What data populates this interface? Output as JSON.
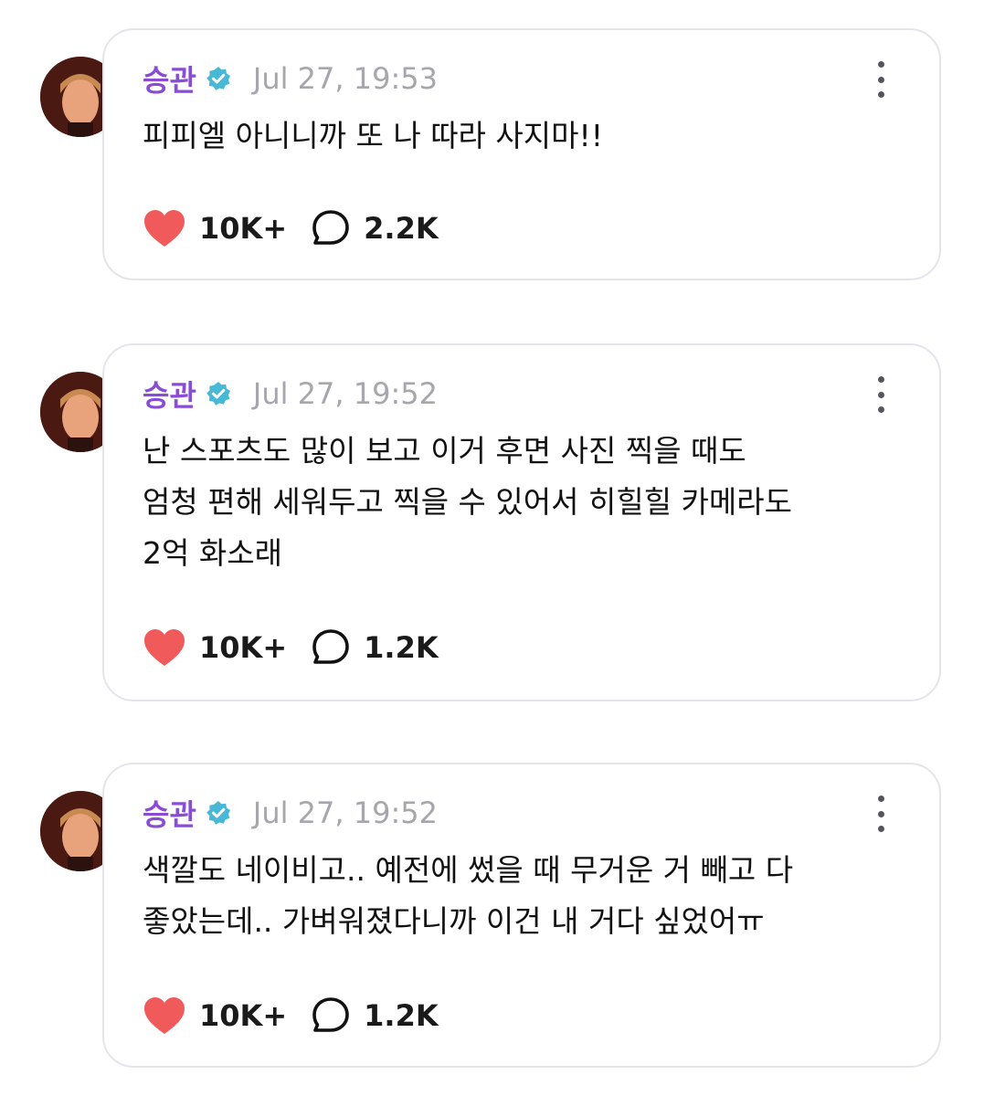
{
  "colors": {
    "username": "#8a4cd6",
    "verified_badge": "#47b9d6",
    "like_heart": "#f05a5a",
    "timestamp": "#a6a6ae"
  },
  "posts": [
    {
      "username": "승관",
      "timestamp": "Jul 27, 19:53",
      "text": "피피엘 아니니까 또 나 따라 사지마!!",
      "likes": "10K+",
      "comments": "2.2K"
    },
    {
      "username": "승관",
      "timestamp": "Jul 27, 19:52",
      "text": "난 스포츠도 많이 보고 이거 후면 사진 찍을 때도\n엄청 편해 세워두고 찍을 수 있어서 히힐힐 카메라도\n2억 화소래",
      "likes": "10K+",
      "comments": "1.2K"
    },
    {
      "username": "승관",
      "timestamp": "Jul 27, 19:52",
      "text": "색깔도 네이비고.. 예전에 썼을 때 무거운 거 빼고 다\n좋았는데.. 가벼워졌다니까 이건 내 거다 싶었어ㅠ",
      "likes": "10K+",
      "comments": "1.2K"
    }
  ],
  "icons": {
    "verified": "verified-badge-icon",
    "more": "more-vertical-icon",
    "like": "heart-icon",
    "comment": "comment-bubble-icon"
  }
}
